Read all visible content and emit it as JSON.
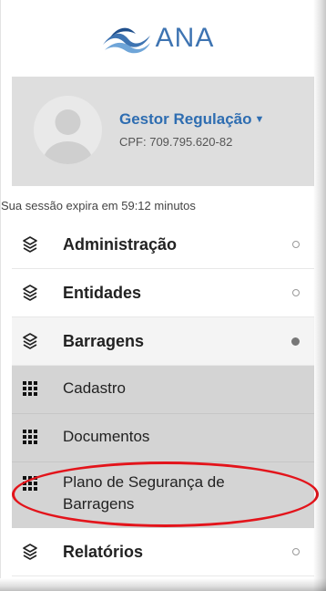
{
  "header": {
    "logo_text": "ANA"
  },
  "profile": {
    "name": "Gestor Regulação",
    "cpf": "CPF: 709.795.620-82"
  },
  "session": {
    "text": "Sua sessão expira em 59:12 minutos"
  },
  "menu": {
    "items": [
      {
        "label": "Administração",
        "state": "collapsed"
      },
      {
        "label": "Entidades",
        "state": "collapsed"
      },
      {
        "label": "Barragens",
        "state": "expanded"
      },
      {
        "label": "Relatórios",
        "state": "collapsed"
      }
    ],
    "barragens_sub": [
      {
        "label": "Cadastro"
      },
      {
        "label": "Documentos"
      },
      {
        "label": "Plano de Segurança de Barragens"
      }
    ]
  },
  "colors": {
    "brand_blue": "#3e74b2",
    "username_blue": "#2e6db1",
    "highlight_red": "#e3141b",
    "submenu_bg": "#d4d4d4",
    "profile_bg": "#dedede"
  },
  "icons": {
    "menu_item": "layers-icon",
    "submenu_item": "grid-dots-icon",
    "profile": "user-avatar-icon",
    "dropdown": "caret-down-icon"
  }
}
